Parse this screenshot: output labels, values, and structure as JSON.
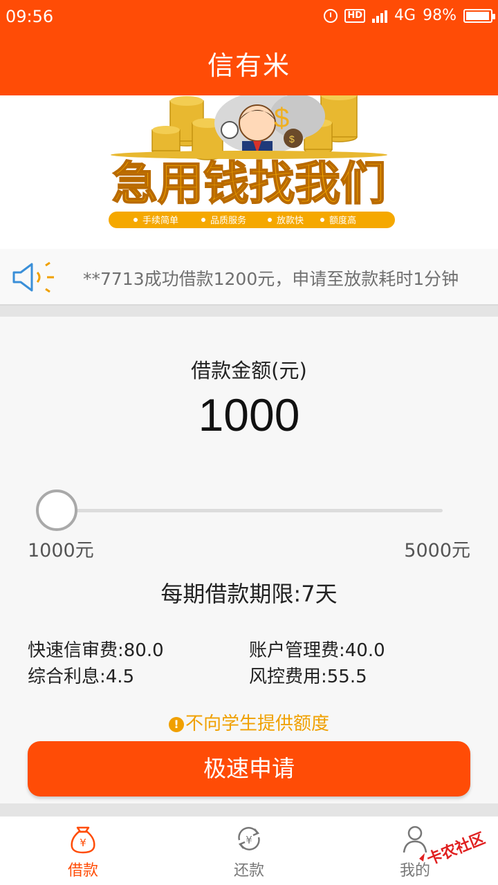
{
  "status_bar": {
    "time": "09:56",
    "hd": "HD",
    "network": "4G",
    "battery_percent": "98%",
    "battery_level": 0.98
  },
  "app_bar": {
    "title": "信有米"
  },
  "banner": {
    "headline": "急用钱找我们",
    "features": [
      "手续简单",
      "品质服务",
      "放款快",
      "额度高"
    ]
  },
  "notice": {
    "text": "**7713成功借款1200元，申请至放款耗时1分钟",
    "icon": "speaker-icon"
  },
  "loan": {
    "amount_label": "借款金额(元)",
    "amount_value": "1000",
    "slider_min": "1000元",
    "slider_max": "5000元",
    "slider_fraction": 0,
    "term_text": "每期借款期限:7天",
    "fees": {
      "review": "快速信审费:80.0",
      "account": "账户管理费:40.0",
      "interest": "综合利息:4.5",
      "risk": "风控费用:55.5"
    },
    "warning_text": "不向学生提供额度",
    "warning_icon": "!",
    "apply_label": "极速申请"
  },
  "tabs": [
    {
      "label": "借款",
      "icon": "money-bag-icon",
      "active": true
    },
    {
      "label": "还款",
      "icon": "repay-yen-icon",
      "active": false
    },
    {
      "label": "我的",
      "icon": "user-icon",
      "active": false
    }
  ],
  "watermark": {
    "text": "卡农社区"
  },
  "colors": {
    "primary": "#ff4c06",
    "warning": "#f0a000",
    "text_gray": "#707070"
  }
}
